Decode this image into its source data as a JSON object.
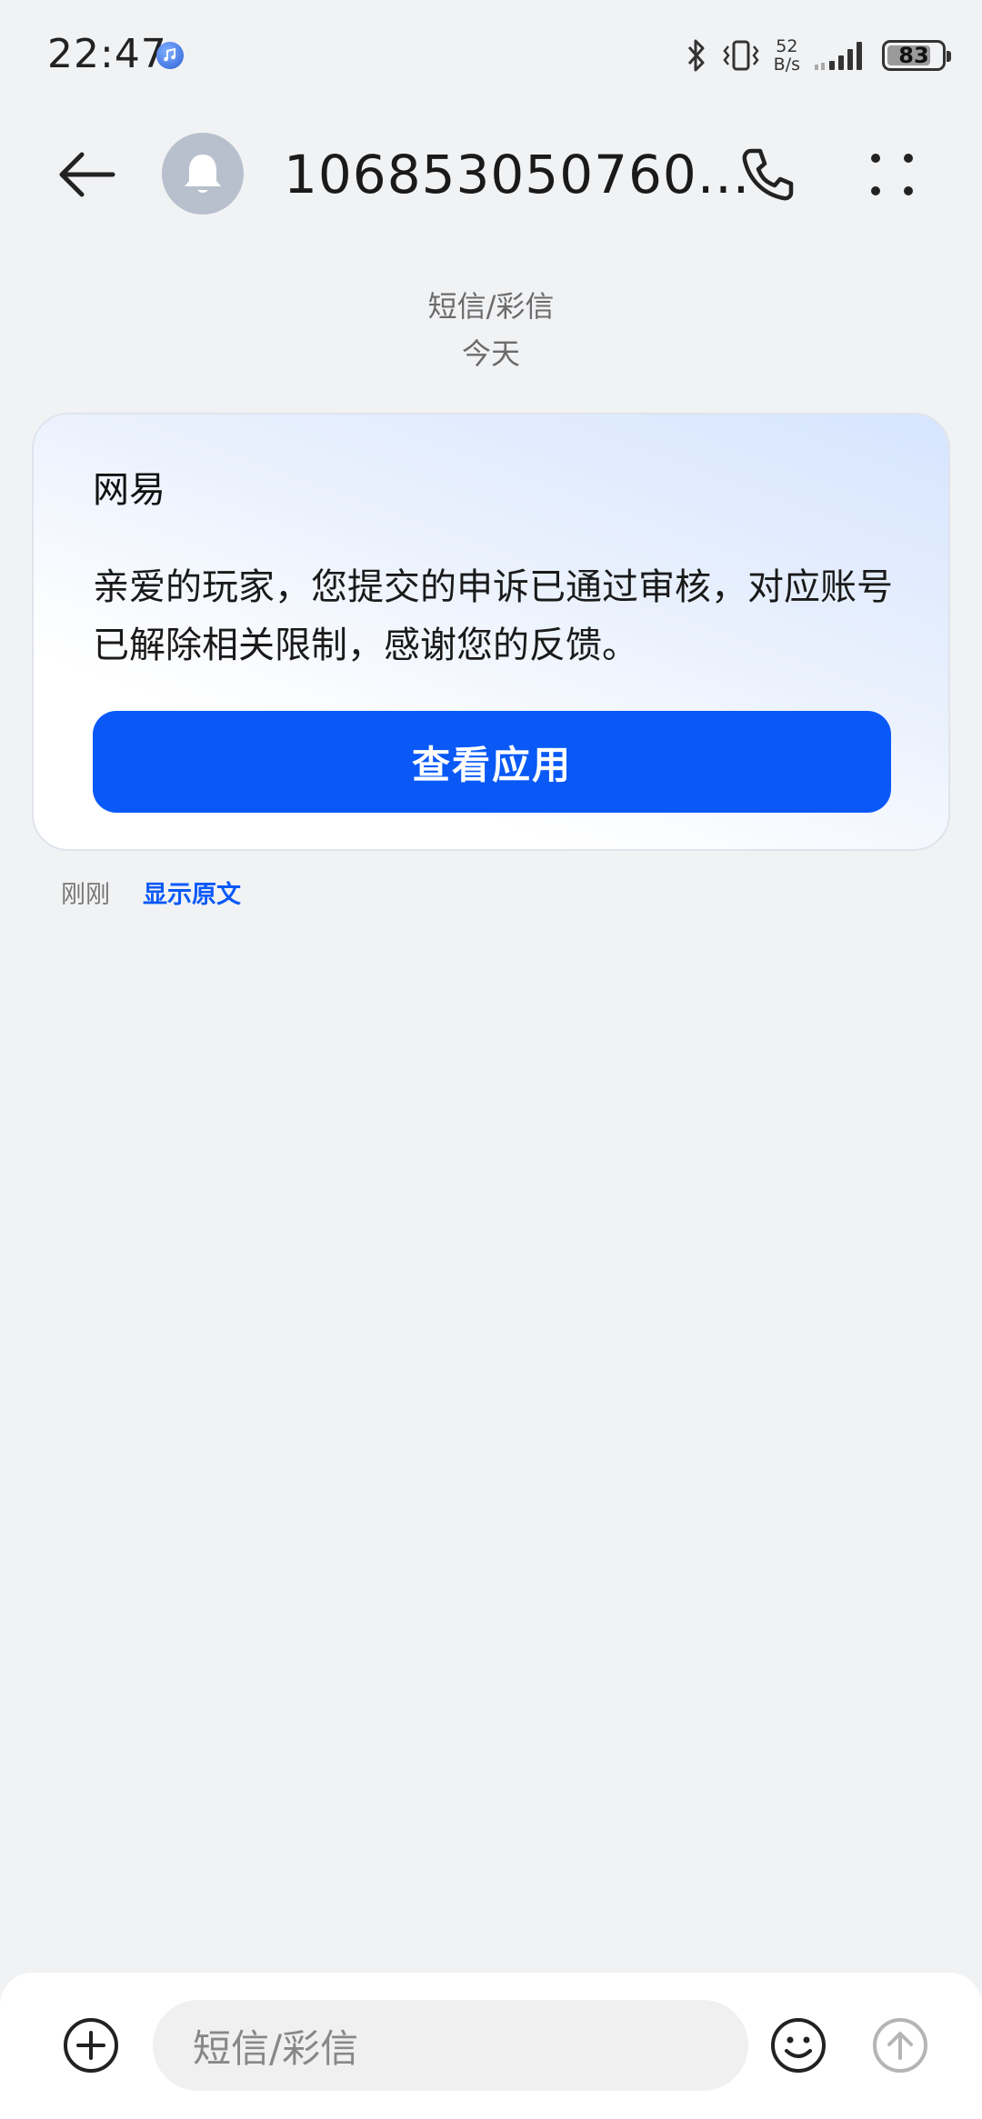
{
  "status_bar": {
    "time": "22:47",
    "net_speed_value": "52",
    "net_speed_unit": "B/s",
    "battery": "83",
    "battery_level": 0.83,
    "icons": [
      "music-app-icon",
      "bluetooth-icon",
      "vibrate-icon",
      "signal-icon",
      "battery-icon"
    ]
  },
  "header": {
    "title": "106853050760...",
    "back_icon": "arrow-left-icon",
    "avatar_icon": "bell-icon",
    "call_icon": "phone-icon",
    "more_icon": "more-dots-icon"
  },
  "conversation": {
    "message_type": "短信/彩信",
    "date_label": "今天"
  },
  "card": {
    "sender": "网易",
    "body": "亲爱的玩家，您提交的申诉已通过审核，对应账号已解除相关限制，感谢您的反馈。",
    "button_label": "查看应用"
  },
  "meta": {
    "time": "刚刚",
    "show_original": "显示原文"
  },
  "input_bar": {
    "placeholder": "短信/彩信",
    "add_icon": "plus-circle-icon",
    "emoji_icon": "smiley-icon",
    "send_icon": "send-arrow-up-icon"
  },
  "colors": {
    "accent": "#0a59f7",
    "background": "#f1f2f4",
    "avatar_bg": "#b7c0cc"
  }
}
